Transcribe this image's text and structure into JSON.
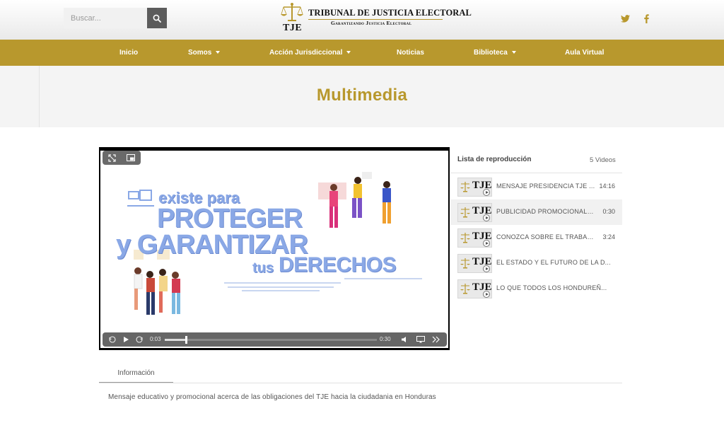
{
  "header": {
    "search_placeholder": "Buscar...",
    "logo_title": "TRIBUNAL DE JUSTICIA ELECTORAL",
    "logo_subtitle": "Garantizando Justicia Electoral",
    "logo_mark": "TJE"
  },
  "nav": {
    "items": [
      {
        "label": "Inicio",
        "dropdown": false
      },
      {
        "label": "Somos",
        "dropdown": true
      },
      {
        "label": "Acción Jurisdiccional",
        "dropdown": true
      },
      {
        "label": "Noticias",
        "dropdown": false
      },
      {
        "label": "Biblioteca",
        "dropdown": true
      },
      {
        "label": "Aula Virtual",
        "dropdown": false
      }
    ]
  },
  "page": {
    "title": "Multimedia"
  },
  "player": {
    "current_time": "0:03",
    "duration": "0:30",
    "progress": 0.1,
    "video_text": {
      "line1": "existe para",
      "line2": "PROTEGER",
      "line3": "y GARANTIZAR",
      "line4a": "tus",
      "line4b": "DERECHOS"
    }
  },
  "playlist": {
    "heading": "Lista de reproducción",
    "count": "5 Videos",
    "thumb_label": "TJE",
    "items": [
      {
        "title": "MENSAJE PRESIDENCIA TJE ...",
        "duration": "14:16",
        "active": false
      },
      {
        "title": "PUBLICIDAD PROMOCIONAL, ...",
        "duration": "0:30",
        "active": true
      },
      {
        "title": "CONOZCA SOBRE EL TRABAJ...",
        "duration": "3:24",
        "active": false
      },
      {
        "title": "EL ESTADO Y EL FUTURO DE LA D...",
        "duration": "",
        "active": false
      },
      {
        "title": "LO QUE TODOS LOS HONDUREÑ...",
        "duration": "",
        "active": false
      }
    ]
  },
  "info": {
    "tab_label": "Información",
    "description": "Mensaje educativo y promocional acerca de las obligaciones del TJE hacia la ciudadania en Honduras"
  },
  "colors": {
    "brand_gold": "#b8982d",
    "title_band": "#f4f4f4",
    "video_text_blue": "#8aa8e6"
  }
}
